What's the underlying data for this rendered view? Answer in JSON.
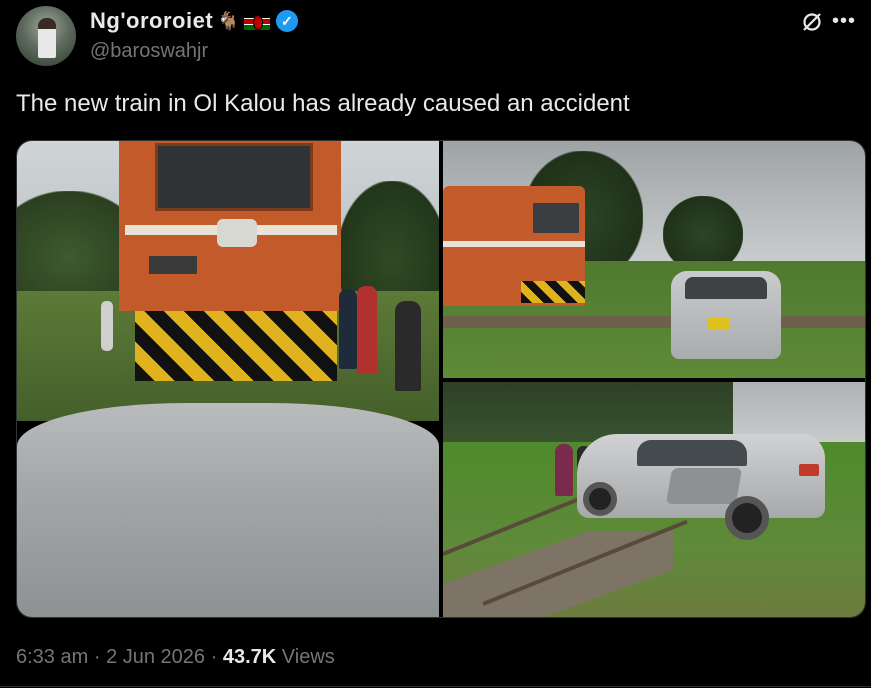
{
  "author": {
    "display_name": "Ng'ororoiet",
    "handle": "@baroswahjr"
  },
  "tweet": {
    "text": "The new train in Ol Kalou has already caused an accident"
  },
  "meta": {
    "time": "6:33 am",
    "date": "2 Jun 2026",
    "views_count": "43.7K",
    "views_label": "Views",
    "separator": "·"
  },
  "icons": {
    "grok": "grok-icon",
    "more": "more-icon",
    "verified": "verified-badge-icon",
    "goat": "goat-emoji-icon",
    "flag": "kenya-flag-icon"
  },
  "photos": [
    {
      "name": "photo-train-front"
    },
    {
      "name": "photo-train-and-car"
    },
    {
      "name": "photo-damaged-car"
    }
  ],
  "colors": {
    "background": "#000000",
    "text": "#e7e9ea",
    "muted": "#71767b",
    "verified": "#1d9bf0",
    "border": "#2f3336"
  }
}
